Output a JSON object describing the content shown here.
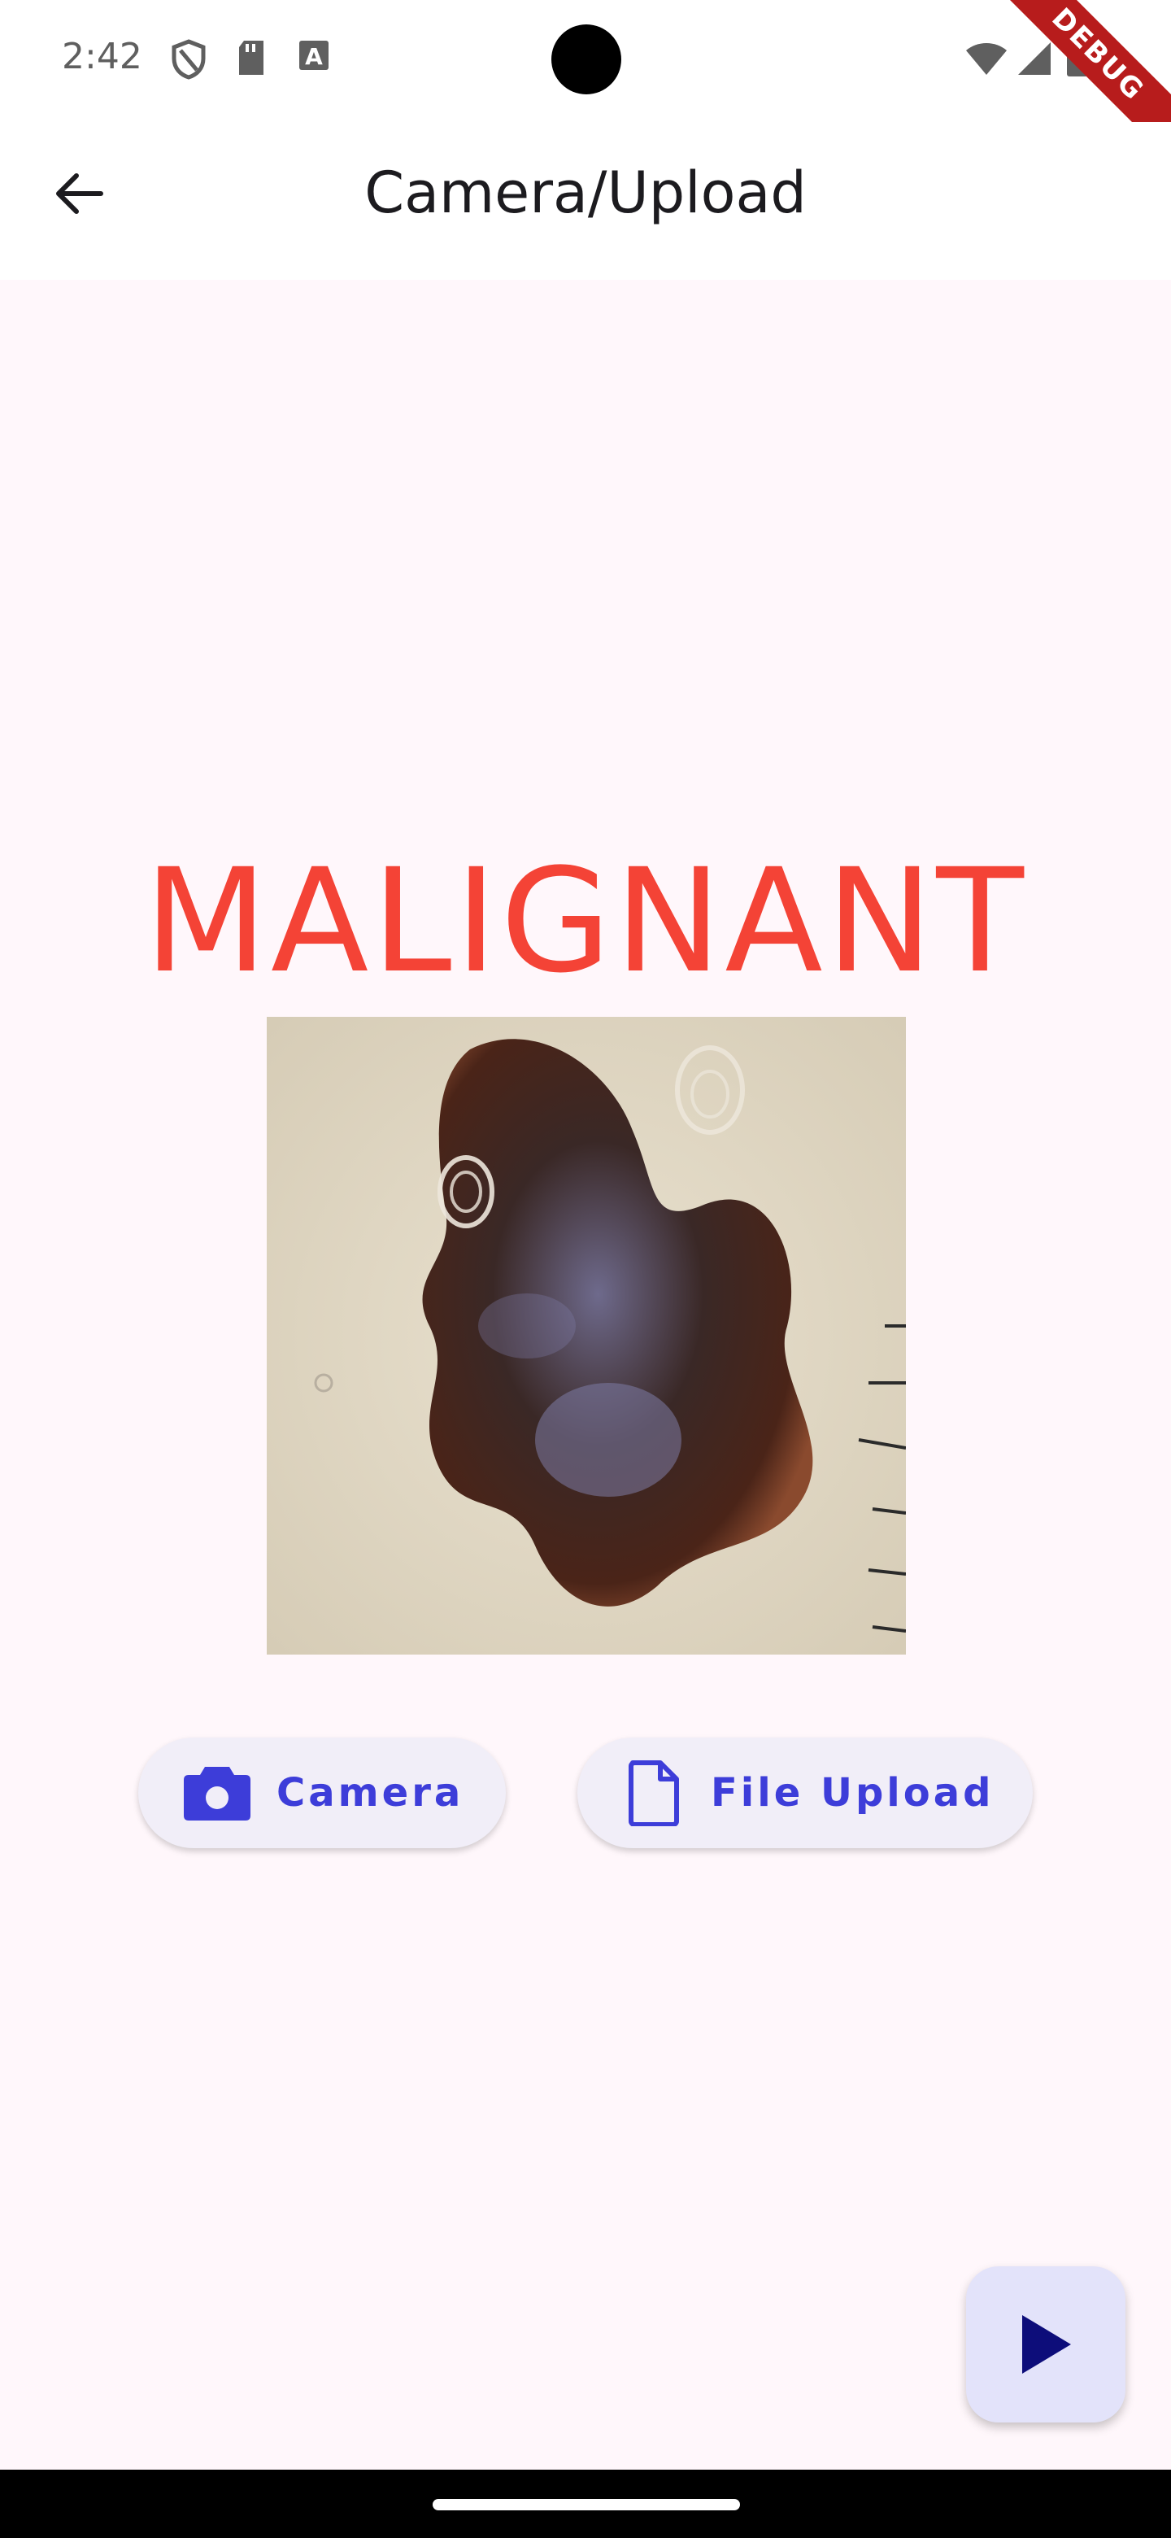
{
  "status_bar": {
    "time": "2:42",
    "icons_left": [
      "shield-icon",
      "sd-card-icon",
      "font-a-icon"
    ],
    "icons_right": [
      "wifi-icon",
      "cell-signal-icon",
      "battery-icon"
    ],
    "debug_banner": "DEBUG"
  },
  "app_bar": {
    "title": "Camera/Upload",
    "back_icon": "arrow-back-icon"
  },
  "result": {
    "label": "MALIGNANT",
    "color": "#F44336"
  },
  "buttons": {
    "camera_label": "Camera",
    "upload_label": "File Upload",
    "accent": "#3D3DD9"
  },
  "fab": {
    "icon": "play-icon"
  }
}
